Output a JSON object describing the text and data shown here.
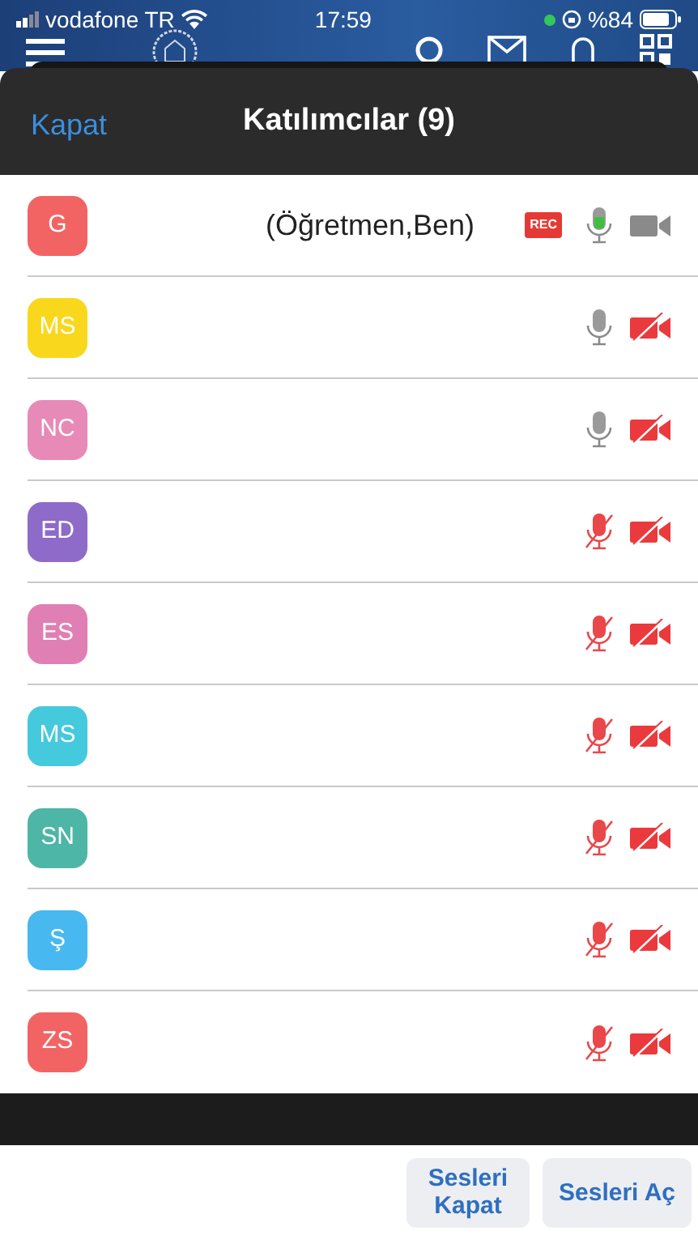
{
  "status_bar": {
    "carrier": "vodafone TR",
    "time": "17:59",
    "battery": "%84"
  },
  "sheet": {
    "close": "Kapat",
    "title": "Katılımcılar (9)"
  },
  "participants": [
    {
      "initials": "G",
      "color": "#f26464",
      "role": "(Öğretmen,Ben)",
      "recording": true,
      "speaking": true,
      "muted": false,
      "video_on": true
    },
    {
      "initials": "MS",
      "color": "#f9d71c",
      "recording": false,
      "speaking": false,
      "muted": false,
      "video_on": false
    },
    {
      "initials": "NC",
      "color": "#e78ab8",
      "recording": false,
      "speaking": false,
      "muted": false,
      "video_on": false
    },
    {
      "initials": "ED",
      "color": "#8e6bc8",
      "recording": false,
      "speaking": false,
      "muted": true,
      "video_on": false
    },
    {
      "initials": "ES",
      "color": "#e07fb3",
      "recording": false,
      "speaking": false,
      "muted": true,
      "video_on": false
    },
    {
      "initials": "MS",
      "color": "#45c9dc",
      "recording": false,
      "speaking": false,
      "muted": true,
      "video_on": false
    },
    {
      "initials": "SN",
      "color": "#4db6a6",
      "recording": false,
      "speaking": false,
      "muted": true,
      "video_on": false
    },
    {
      "initials": "Ş",
      "color": "#47b8f0",
      "recording": false,
      "speaking": false,
      "muted": true,
      "video_on": false
    },
    {
      "initials": "ZS",
      "color": "#f26464",
      "recording": false,
      "speaking": false,
      "muted": true,
      "video_on": false
    }
  ],
  "rec_label": "REC",
  "buttons": [
    "Sesleri Kapat",
    "Sesleri Aç"
  ]
}
